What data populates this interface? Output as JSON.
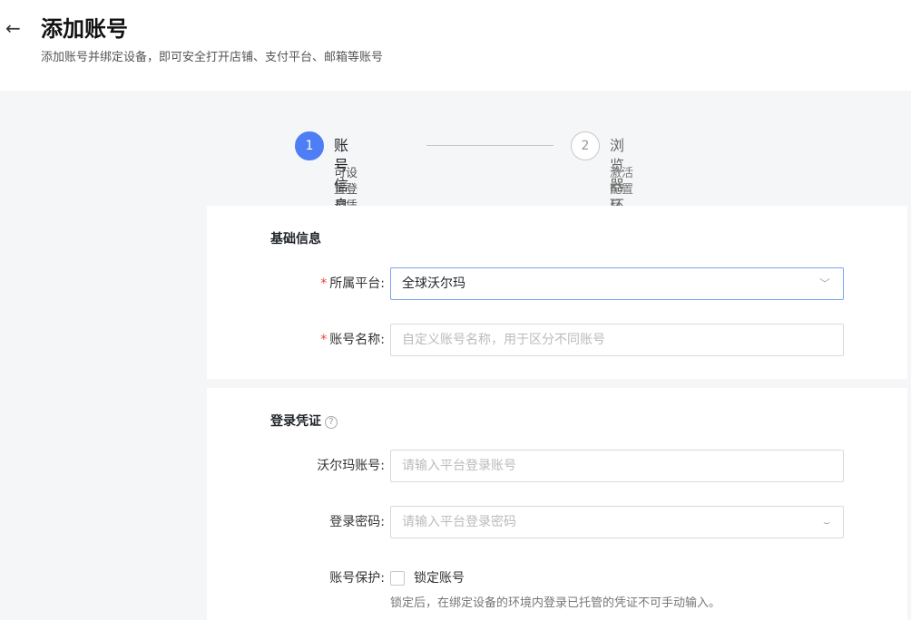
{
  "header": {
    "back_glyph": "←",
    "title": "添加账号",
    "subtitle": "添加账号并绑定设备，即可安全打开店铺、支付平台、邮箱等账号"
  },
  "steps": [
    {
      "number": "1",
      "title": "账号信息",
      "desc": "可设置登录凭证、绑定设备等",
      "active": true
    },
    {
      "number": "2",
      "title": "浏览器环境配置",
      "desc": "激活配置后，将自动生成环境信息",
      "active": false
    }
  ],
  "basic": {
    "title": "基础信息",
    "platform_label": "所属平台:",
    "platform_value": "全球沃尔玛",
    "name_label": "账号名称:",
    "name_placeholder": "自定义账号名称，用于区分不同账号",
    "required_mark": "*"
  },
  "login": {
    "title": "登录凭证",
    "help_glyph": "?",
    "account_label": "沃尔玛账号:",
    "account_placeholder": "请输入平台登录账号",
    "password_label": "登录密码:",
    "password_placeholder": "请输入平台登录密码",
    "protect_label": "账号保护:",
    "lock_label": "锁定账号",
    "lock_hint": "锁定后，在绑定设备的环境内登录已托管的凭证不可手动输入。",
    "lock_checked": false
  },
  "icons": {
    "chevron": "﹀",
    "eye_closed": "⌣"
  },
  "colors": {
    "primary": "#4e7ef5",
    "required": "#f04134",
    "page_bg": "#f5f6f7"
  }
}
